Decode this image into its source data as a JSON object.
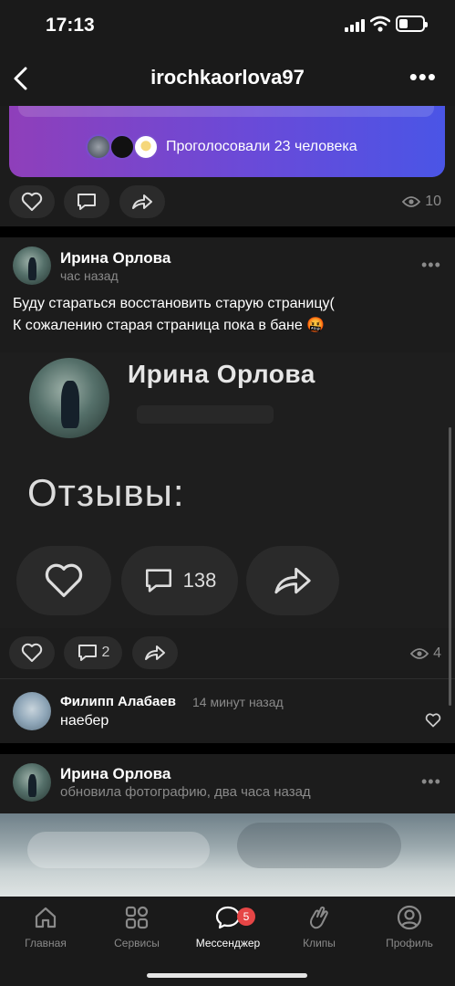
{
  "status_bar": {
    "time": "17:13"
  },
  "header": {
    "title": "irochkaorlova97"
  },
  "poll": {
    "votes_text": "Проголосовали 23 человека"
  },
  "post1_actions": {
    "views": "10"
  },
  "post2": {
    "author": "Ирина Орлова",
    "time": "час назад",
    "text_line1": "Буду стараться восстановить старую страницу(",
    "text_line2": "К сожалению старая страница пока в бане 🤬",
    "image": {
      "name": "Ирина Орлова",
      "section": "Отзывы:",
      "comments": "138"
    },
    "comments_count": "2",
    "views": "4"
  },
  "comment": {
    "author": "Филипп Алабаев",
    "time": "14 минут назад",
    "text": "наебер"
  },
  "post3": {
    "author": "Ирина Орлова",
    "meta": "обновила фотографию, два часа назад"
  },
  "bottom_nav": {
    "items": [
      {
        "label": "Главная"
      },
      {
        "label": "Сервисы"
      },
      {
        "label": "Мессенджер"
      },
      {
        "label": "Клипы"
      },
      {
        "label": "Профиль"
      }
    ],
    "messenger_badge": "5"
  }
}
